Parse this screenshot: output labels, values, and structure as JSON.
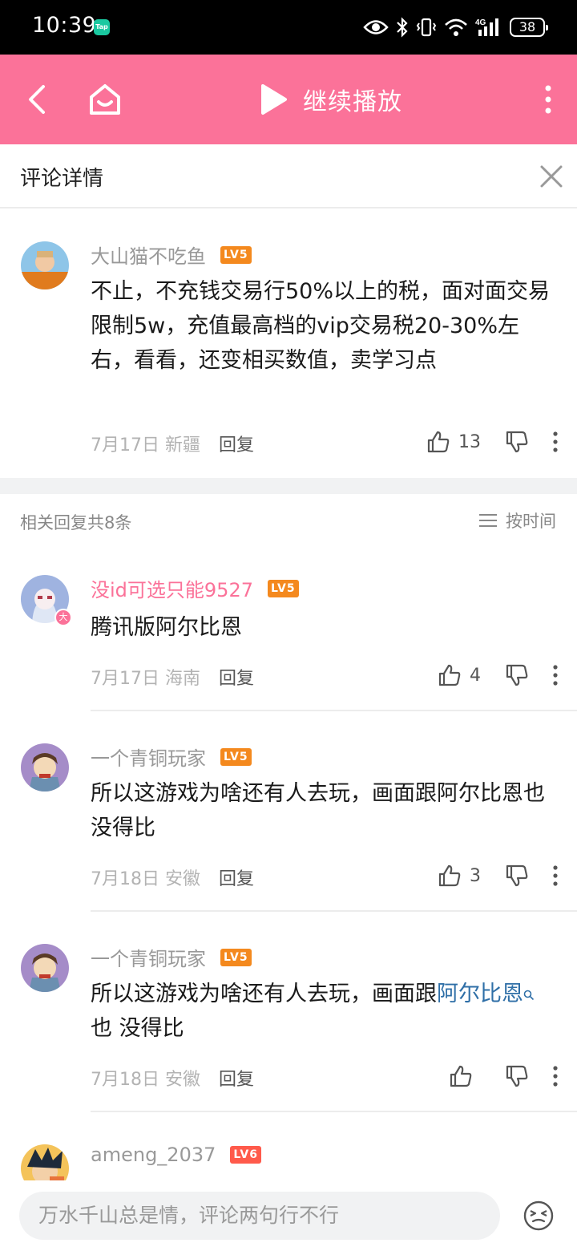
{
  "status_bar": {
    "time": "10:39",
    "app_badge": "Tap",
    "network": "4G",
    "battery": "38"
  },
  "app_bar": {
    "continue_label": "继续播放",
    "accent_color": "#fb7299"
  },
  "detail": {
    "title": "评论详情"
  },
  "main_comment": {
    "user": "大山猫不吃鱼",
    "level": "LV5",
    "text": "不止，不充钱交易行50%以上的税，面对面交易限制5w，充值最高档的vip交易税20-30%左右，看看，还变相买数值，卖学习点",
    "date": "7月17日",
    "region": "新疆",
    "reply_label": "回复",
    "likes": "13"
  },
  "replies_header": {
    "count_label": "相关回复共8条",
    "sort_label": "按时间"
  },
  "replies": [
    {
      "user": "没id可选只能9527",
      "level": "LV5",
      "vip_badge": "大",
      "text": "腾讯版阿尔比恩",
      "date": "7月17日",
      "region": "海南",
      "reply_label": "回复",
      "likes": "4"
    },
    {
      "user": "一个青铜玩家",
      "level": "LV5",
      "text": "所以这游戏为啥还有人去玩，画面跟阿尔比恩也 没得比",
      "date": "7月18日",
      "region": "安徽",
      "reply_label": "回复",
      "likes": "3"
    },
    {
      "user": "一个青铜玩家",
      "level": "LV5",
      "text_before": "所以这游戏为啥还有人去玩，画面跟",
      "text_link": "阿尔比恩",
      "text_after": "也 没得比",
      "date": "7月18日",
      "region": "安徽",
      "reply_label": "回复",
      "likes": ""
    },
    {
      "user": "ameng_2037",
      "level": "LV6"
    }
  ],
  "bottom_bar": {
    "input_placeholder": "万水千山总是情，评论两句行不行"
  }
}
